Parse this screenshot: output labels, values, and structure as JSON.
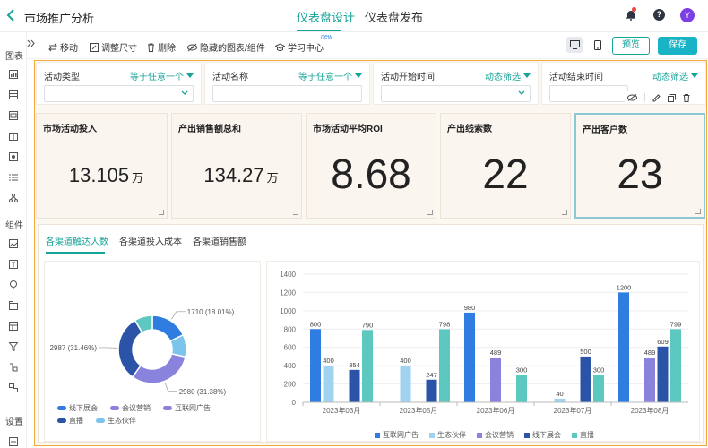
{
  "header": {
    "app_title": "市场推广分析",
    "tabs": [
      {
        "label": "仪表盘设计",
        "active": true
      },
      {
        "label": "仪表盘发布",
        "active": false
      }
    ],
    "avatar_initial": "Y",
    "accent_color": "#17a398"
  },
  "rail": {
    "sections": [
      "图表",
      "组件",
      "设置"
    ],
    "chart_icons": [
      "bar-chart-icon",
      "table-icon",
      "pivot-icon",
      "card-icon",
      "map-icon",
      "list-icon",
      "tree-icon"
    ],
    "component_icons": [
      "image-icon",
      "text-icon",
      "filter-icon",
      "tab-icon",
      "layout-icon",
      "funnel-icon",
      "param-icon",
      "group-icon"
    ]
  },
  "toolbar": {
    "move_label": "移动",
    "resize_label": "调整尺寸",
    "delete_label": "删除",
    "hidden_label": "隐藏的图表/组件",
    "learn_label": "学习中心",
    "new_badge": "new",
    "preview_label": "预览",
    "save_label": "保存"
  },
  "filters": [
    {
      "label": "活动类型",
      "mode": "等于任意一个"
    },
    {
      "label": "活动名称",
      "mode": "等于任意一个"
    },
    {
      "label": "活动开始时间",
      "mode": "动态筛选"
    },
    {
      "label": "活动结束时间",
      "mode": "动态筛选"
    }
  ],
  "kpis": [
    {
      "title": "市场活动投入",
      "value": "13.105",
      "unit": "万"
    },
    {
      "title": "产出销售额总和",
      "value": "134.27",
      "unit": "万"
    },
    {
      "title": "市场活动平均ROI",
      "value": "8.68",
      "unit": ""
    },
    {
      "title": "产出线索数",
      "value": "22",
      "unit": ""
    },
    {
      "title": "产出客户数",
      "value": "23",
      "unit": "",
      "selected": true
    }
  ],
  "panel_tabs": [
    {
      "label": "各渠道触达人数",
      "active": true
    },
    {
      "label": "各渠道投入成本",
      "active": false
    },
    {
      "label": "各渠道销售额",
      "active": false
    }
  ],
  "chart_data": [
    {
      "type": "pie",
      "variant": "donut",
      "title": "",
      "labels": [
        "互联网广告",
        "生态伙伴",
        "会议营销",
        "直播",
        "线下展会"
      ],
      "values": [
        1710,
        1000,
        2980,
        2987,
        818
      ],
      "colors": [
        "#2f7de1",
        "#7cc4ec",
        "#8a83de",
        "#2b54a8",
        "#5cc8c0"
      ],
      "data_labels": [
        {
          "series": "互联网广告",
          "text": "1710 (18.01%)"
        },
        {
          "series": "会议营销",
          "text": "2980 (31.38%)"
        },
        {
          "series": "直播",
          "text": "2987 (31.46%)"
        }
      ],
      "legend": [
        "线下展会",
        "会议营销",
        "互联网广告",
        "直播",
        "生态伙伴"
      ],
      "legend_colors": [
        "#2f7de1",
        "#8a83de",
        "#8a83de",
        "#2b54a8",
        "#7cc4ec"
      ],
      "legend_position": "bottom"
    },
    {
      "type": "bar",
      "title": "",
      "xlabel": "",
      "ylabel": "",
      "categories": [
        "2023年03月",
        "2023年05月",
        "2023年06月",
        "2023年07月",
        "2023年08月"
      ],
      "series": [
        {
          "name": "互联网广告",
          "color": "#2f7de1",
          "values": [
            800,
            null,
            980,
            null,
            1200
          ]
        },
        {
          "name": "生态伙伴",
          "color": "#9fd3f0",
          "values": [
            400,
            400,
            null,
            40,
            null
          ]
        },
        {
          "name": "会议营销",
          "color": "#8a83de",
          "values": [
            null,
            null,
            489,
            null,
            489
          ]
        },
        {
          "name": "线下展会",
          "color": "#2b54a8",
          "values": [
            354,
            247,
            null,
            500,
            609
          ]
        },
        {
          "name": "直播",
          "color": "#5cc8c0",
          "values": [
            790,
            798,
            300,
            300,
            799
          ]
        }
      ],
      "ylim": [
        0,
        1400
      ],
      "yticks": [
        0,
        200,
        400,
        600,
        800,
        1000,
        1200,
        1400
      ],
      "grid": true,
      "legend_position": "bottom"
    }
  ]
}
